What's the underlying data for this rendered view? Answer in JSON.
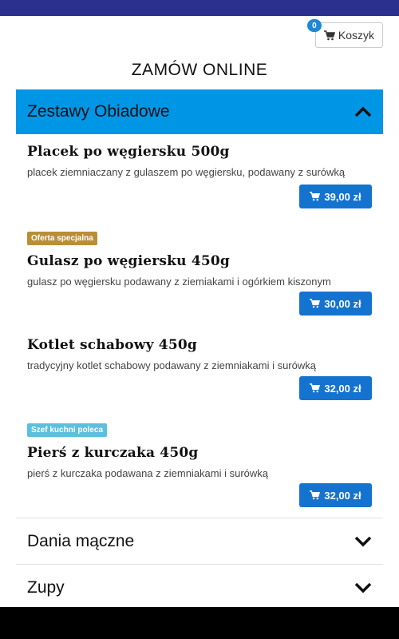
{
  "cart": {
    "label": "Koszyk",
    "count": "0",
    "icon": "cart-icon"
  },
  "title": "ZAMÓW ONLINE",
  "colors": {
    "accent": "#0096e6",
    "price_button": "#1573d0",
    "badge_special": "#b88f36",
    "badge_chef": "#5bc0de",
    "status_bar": "#2b2f8e"
  },
  "categories": [
    {
      "label": "Zestawy Obiadowe",
      "expanded": true,
      "icon": "chevron-up-icon",
      "products": [
        {
          "name": "Placek po węgiersku 500g",
          "description": "placek ziemniaczany z gulaszem po węgiersku, podawany z surówką",
          "price": "39,00 zł",
          "badge": ""
        },
        {
          "name": "Gulasz po węgiersku 450g",
          "description": "gulasz po węgiersku podawany z ziemiakami i ogórkiem kiszonym",
          "price": "30,00 zł",
          "badge": "Oferta specjalna"
        },
        {
          "name": "Kotlet schabowy 450g",
          "description": "tradycyjny kotlet schabowy podawany z ziemniakami i surówką",
          "price": "32,00 zł",
          "badge": ""
        },
        {
          "name": "Pierś z kurczaka 450g",
          "description": "pierś z kurczaka podawana z ziemniakami i surówką",
          "price": "32,00 zł",
          "badge": "Szef kuchni poleca"
        }
      ]
    },
    {
      "label": "Dania mączne",
      "expanded": false,
      "icon": "chevron-down-icon"
    },
    {
      "label": "Zupy",
      "expanded": false,
      "icon": "chevron-down-icon"
    }
  ]
}
